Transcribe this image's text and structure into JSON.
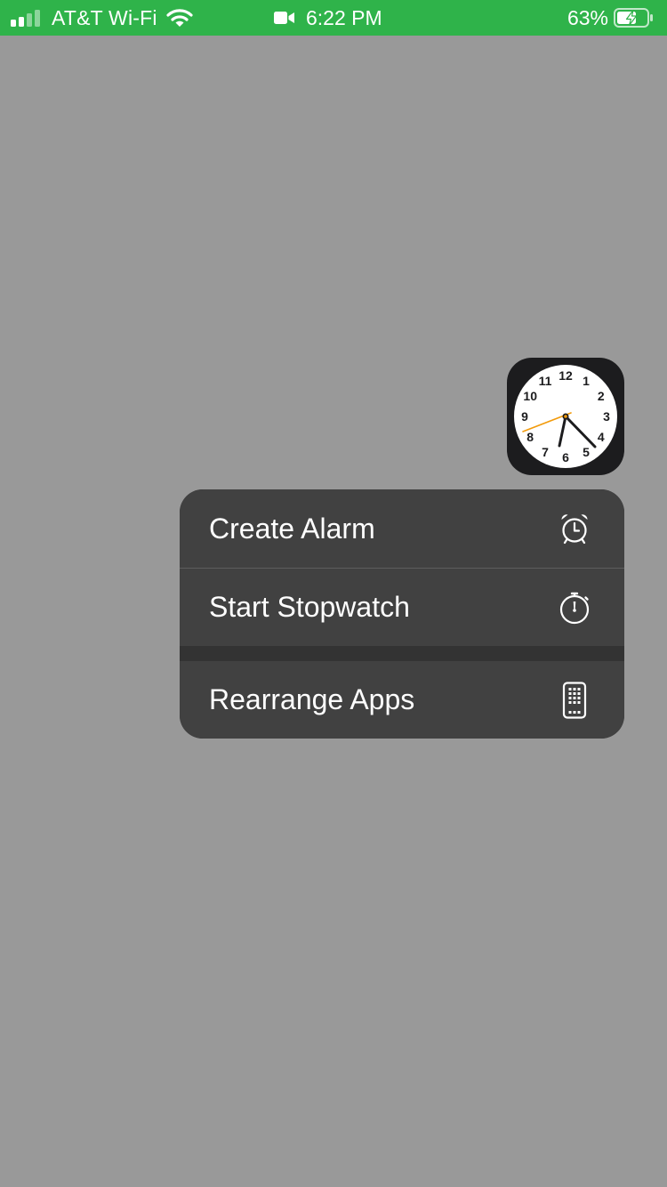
{
  "status_bar": {
    "carrier": "AT&T Wi-Fi",
    "time": "6:22 PM",
    "battery_percent": "63%",
    "background_color": "#2fb34a",
    "icons": [
      "signal-bars-icon",
      "wifi-icon",
      "video-camera-icon",
      "battery-charging-icon"
    ]
  },
  "clock_icon": {
    "icon": "clock-app-icon",
    "numerals": [
      "12",
      "1",
      "2",
      "3",
      "4",
      "5",
      "6",
      "7",
      "8",
      "9",
      "10",
      "11"
    ],
    "second_hand_color": "#f29b0c"
  },
  "context_menu": {
    "items": [
      {
        "label": "Create Alarm",
        "icon": "alarm-clock-icon"
      },
      {
        "label": "Start Stopwatch",
        "icon": "stopwatch-icon"
      },
      {
        "label": "Rearrange Apps",
        "icon": "rearrange-apps-icon"
      }
    ]
  }
}
